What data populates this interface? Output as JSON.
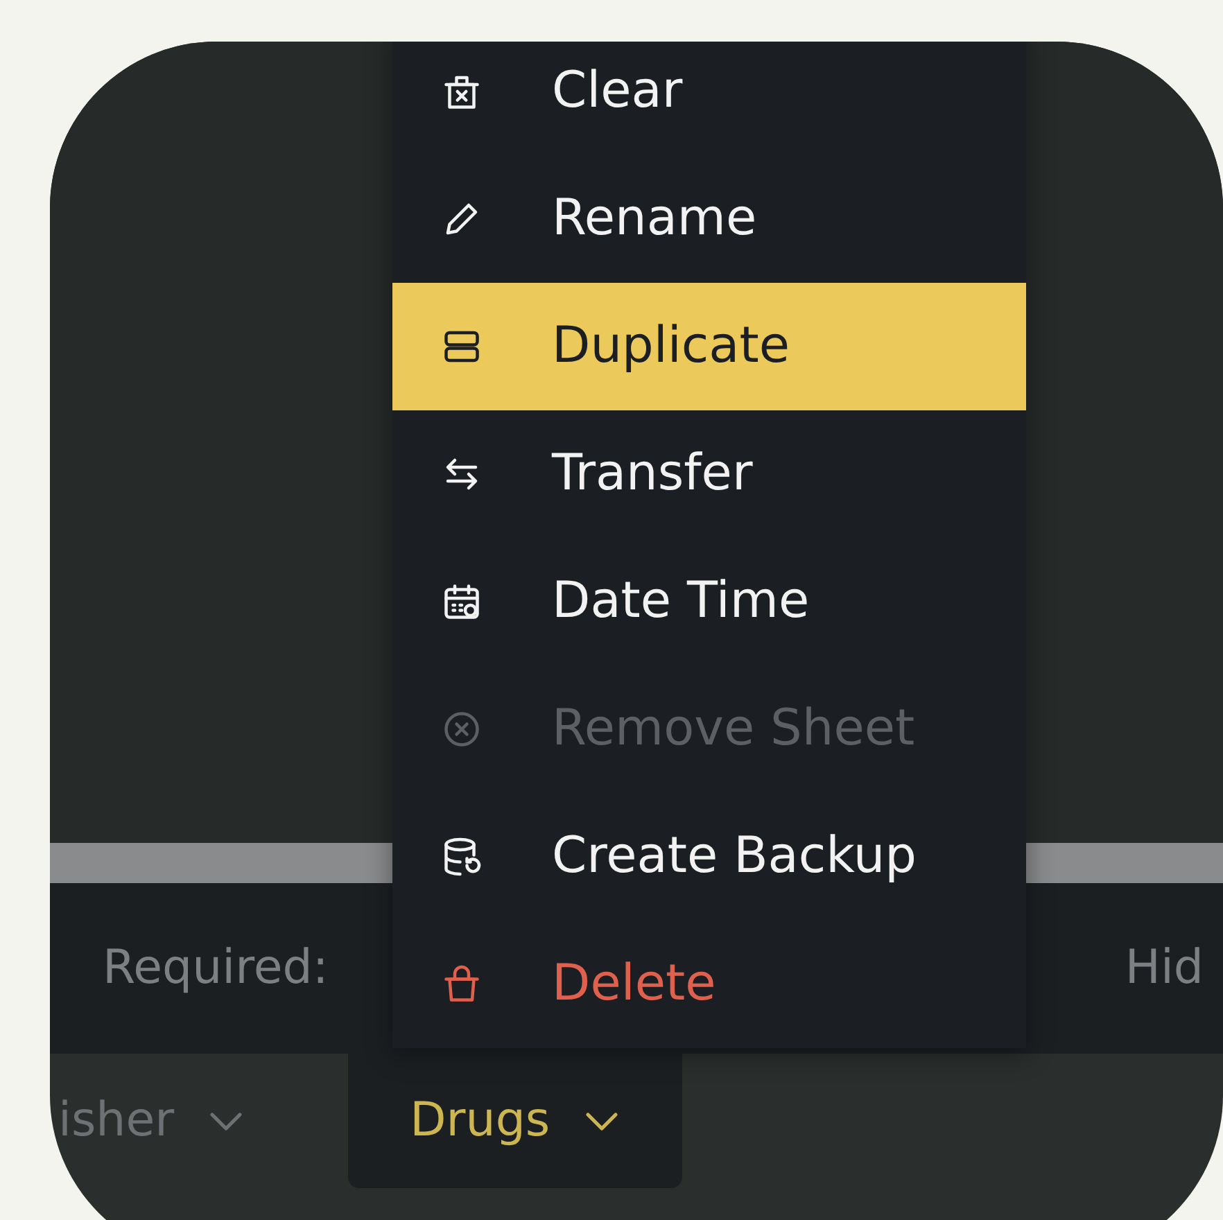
{
  "context_menu": {
    "items": [
      {
        "label": "Clear",
        "selected": false,
        "disabled": false,
        "danger": false
      },
      {
        "label": "Rename",
        "selected": false,
        "disabled": false,
        "danger": false
      },
      {
        "label": "Duplicate",
        "selected": true,
        "disabled": false,
        "danger": false
      },
      {
        "label": "Transfer",
        "selected": false,
        "disabled": false,
        "danger": false
      },
      {
        "label": "Date Time",
        "selected": false,
        "disabled": false,
        "danger": false
      },
      {
        "label": "Remove Sheet",
        "selected": false,
        "disabled": true,
        "danger": false
      },
      {
        "label": "Create Backup",
        "selected": false,
        "disabled": false,
        "danger": false
      },
      {
        "label": "Delete",
        "selected": false,
        "disabled": false,
        "danger": true
      }
    ]
  },
  "info_bar": {
    "texts": [
      "Required:",
      "Hid"
    ]
  },
  "sheet_tabs": [
    {
      "label": "isher",
      "selected": false
    },
    {
      "label": "Drugs",
      "selected": true
    }
  ]
}
